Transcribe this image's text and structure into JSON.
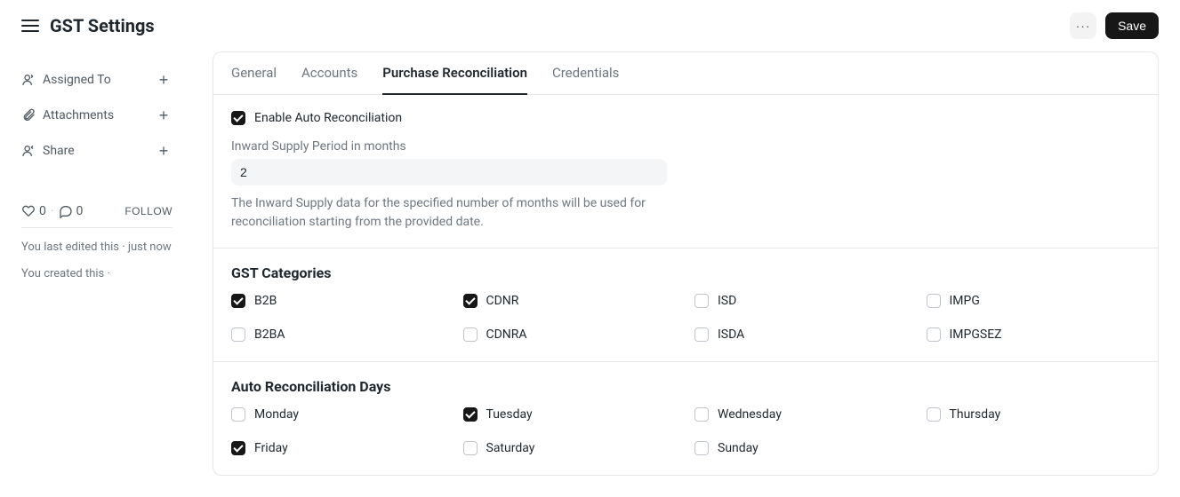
{
  "header": {
    "title": "GST Settings",
    "save_label": "Save"
  },
  "sidebar": {
    "assigned_to_label": "Assigned To",
    "attachments_label": "Attachments",
    "share_label": "Share",
    "like_count": "0",
    "comment_count": "0",
    "follow_label": "FOLLOW",
    "meta_edited": "You last edited this · just now",
    "meta_created": "You created this ·"
  },
  "tabs": [
    {
      "label": "General",
      "active": false
    },
    {
      "label": "Accounts",
      "active": false
    },
    {
      "label": "Purchase Reconciliation",
      "active": true
    },
    {
      "label": "Credentials",
      "active": false
    }
  ],
  "reconcile": {
    "enable_label": "Enable Auto Reconciliation",
    "enable_checked": true,
    "period_label": "Inward Supply Period in months",
    "period_value": "2",
    "period_help": "The Inward Supply data for the specified number of months will be used for reconciliation starting from the provided date."
  },
  "categories": {
    "title": "GST Categories",
    "items": [
      {
        "label": "B2B",
        "checked": true
      },
      {
        "label": "CDNR",
        "checked": true
      },
      {
        "label": "ISD",
        "checked": false
      },
      {
        "label": "IMPG",
        "checked": false
      },
      {
        "label": "B2BA",
        "checked": false
      },
      {
        "label": "CDNRA",
        "checked": false
      },
      {
        "label": "ISDA",
        "checked": false
      },
      {
        "label": "IMPGSEZ",
        "checked": false
      }
    ]
  },
  "days": {
    "title": "Auto Reconciliation Days",
    "items": [
      {
        "label": "Monday",
        "checked": false
      },
      {
        "label": "Tuesday",
        "checked": true
      },
      {
        "label": "Wednesday",
        "checked": false
      },
      {
        "label": "Thursday",
        "checked": false
      },
      {
        "label": "Friday",
        "checked": true
      },
      {
        "label": "Saturday",
        "checked": false
      },
      {
        "label": "Sunday",
        "checked": false
      }
    ]
  }
}
